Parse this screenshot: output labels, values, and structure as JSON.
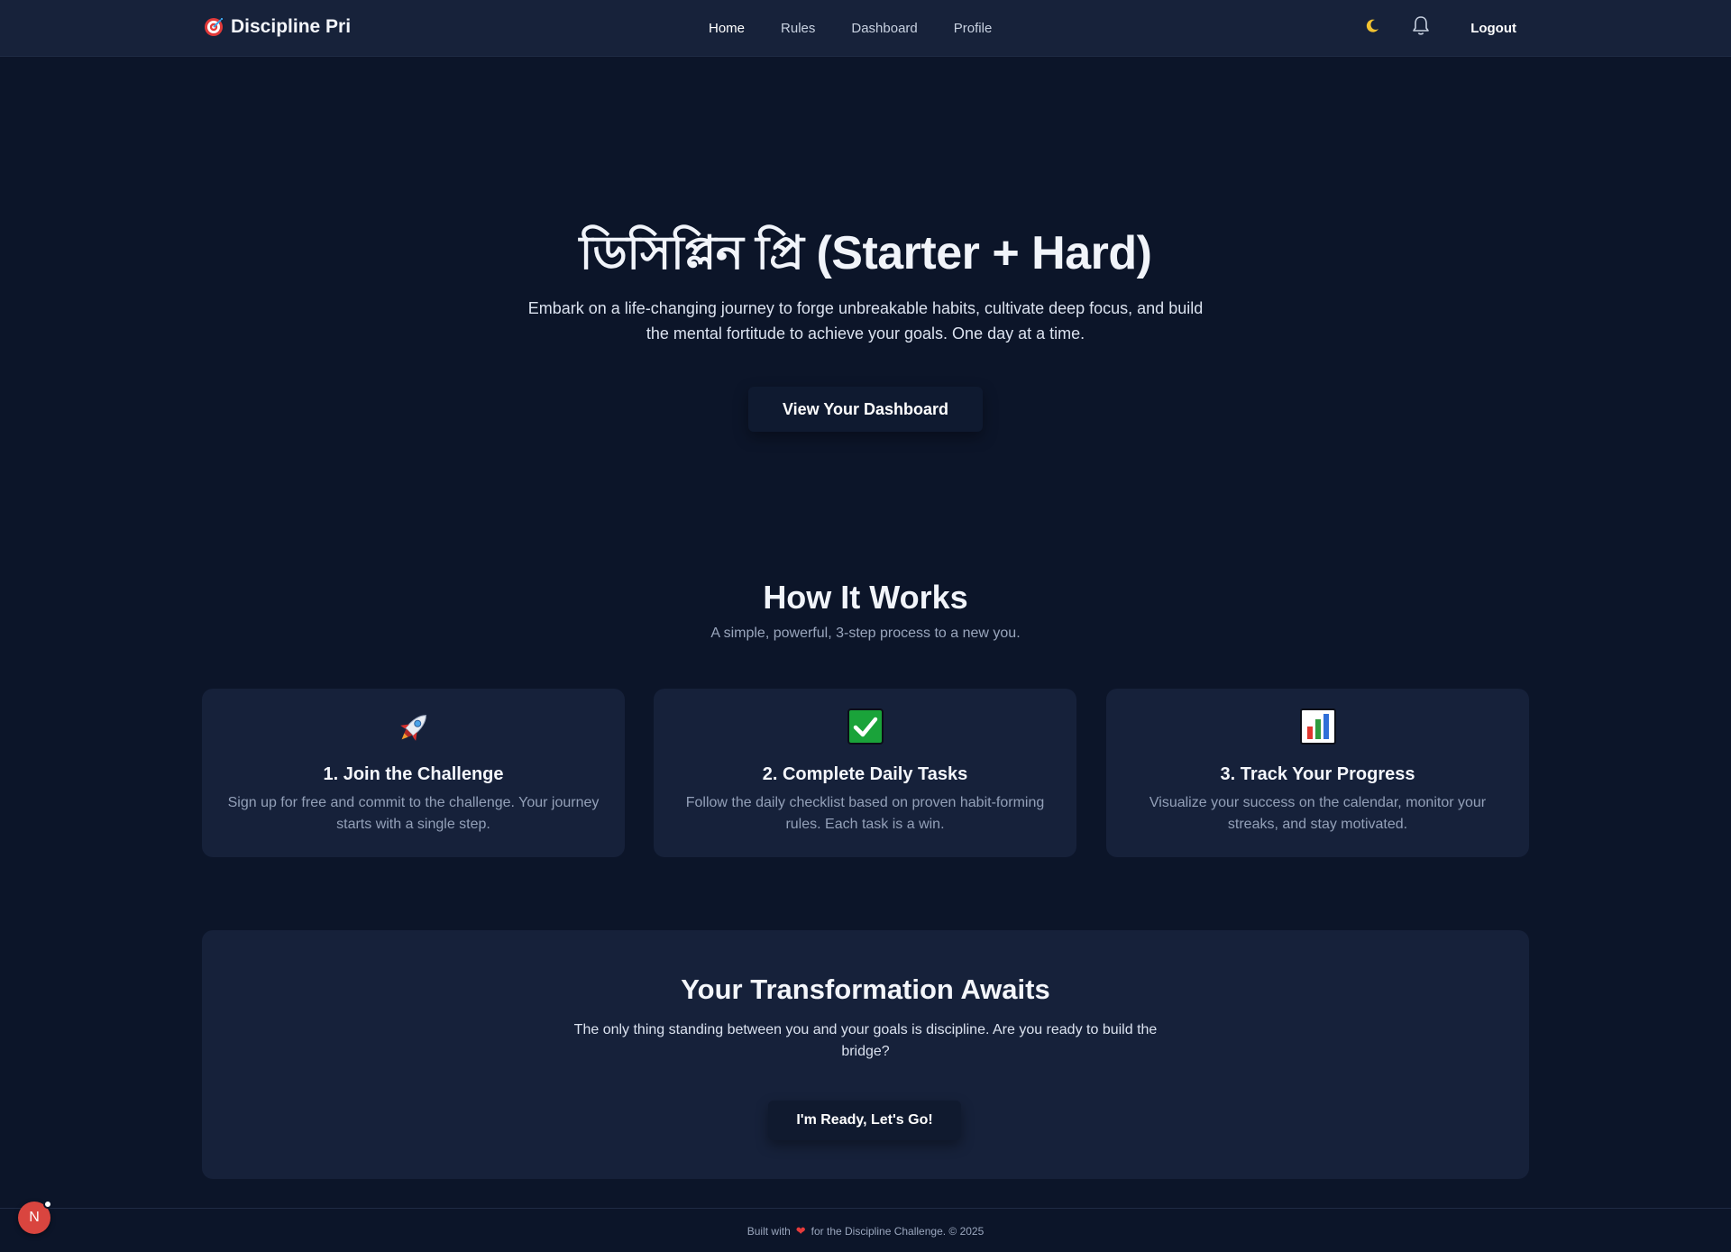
{
  "nav": {
    "brand": "Discipline Pri",
    "brand_icon": "target-icon",
    "links": [
      "Home",
      "Rules",
      "Dashboard",
      "Profile"
    ],
    "active": "Home",
    "theme_icon": "moon-icon",
    "bell_icon": "bell-icon",
    "logout": "Logout"
  },
  "hero": {
    "title": "ডিসিপ্লিন প্রি (Starter + Hard)",
    "subtitle": "Embark on a life-changing journey to forge unbreakable habits, cultivate deep focus, and build the mental fortitude to achieve your goals. One day at a time.",
    "button": "View Your Dashboard"
  },
  "how": {
    "title": "How It Works",
    "subtitle": "A simple, powerful, 3-step process to a new you.",
    "cards": [
      {
        "icon": "rocket-icon",
        "title": "1. Join the Challenge",
        "text": "Sign up for free and commit to the challenge. Your journey starts with a single step."
      },
      {
        "icon": "checkmark-icon",
        "title": "2. Complete Daily Tasks",
        "text": "Follow the daily checklist based on proven habit-forming rules. Each task is a win."
      },
      {
        "icon": "bar-chart-icon",
        "title": "3. Track Your Progress",
        "text": "Visualize your success on the calendar, monitor your streaks, and stay motivated."
      }
    ]
  },
  "cta": {
    "title": "Your Transformation Awaits",
    "text": "The only thing standing between you and your goals is discipline. Are you ready to build the bridge?",
    "button": "I'm Ready, Let's Go!"
  },
  "footer": {
    "prefix": "Built with",
    "suffix": "for the Discipline Challenge. © 2025"
  },
  "avatar": {
    "initial": "N"
  },
  "colors": {
    "background": "#0c1529",
    "navbar": "#17223a",
    "card": "#16213a",
    "muted_text": "#93a0b8",
    "heart": "#e63b3b",
    "avatar": "#d9453f"
  }
}
